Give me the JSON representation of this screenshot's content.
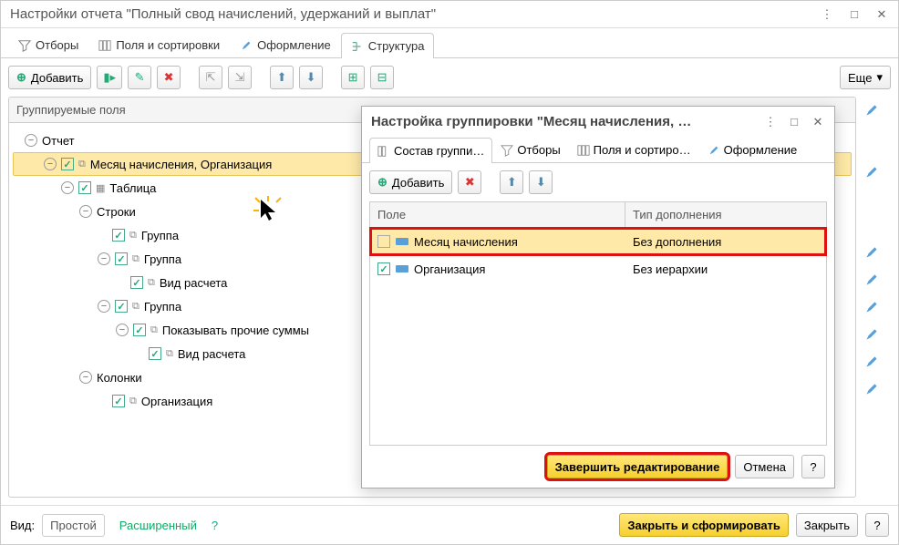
{
  "window": {
    "title": "Настройки отчета \"Полный свод начислений, удержаний и выплат\""
  },
  "mainTabs": {
    "t0": "Отборы",
    "t1": "Поля и сортировки",
    "t2": "Оформление",
    "t3": "Структура"
  },
  "toolbar": {
    "add": "Добавить",
    "more": "Еще"
  },
  "tree": {
    "header": "Группируемые поля",
    "root": "Отчет",
    "n1": "Месяц начисления, Организация",
    "n2": "Таблица",
    "n3": "Строки",
    "n4": "Группа",
    "n5": "Группа",
    "n6": "Вид расчета",
    "n7": "Группа",
    "n8": "Показывать прочие суммы",
    "n9": "Вид расчета",
    "n10": "Колонки",
    "n11": "Организация"
  },
  "popup": {
    "title": "Настройка группировки \"Месяц начисления, …",
    "tabs": {
      "t0": "Состав группи…",
      "t1": "Отборы",
      "t2": "Поля и сортиро…",
      "t3": "Оформление"
    },
    "add": "Добавить",
    "col1": "Поле",
    "col2": "Тип дополнения",
    "rows": [
      {
        "field": "Месяц начисления",
        "type": "Без дополнения",
        "checked": false
      },
      {
        "field": "Организация",
        "type": "Без иерархии",
        "checked": true
      }
    ],
    "finish": "Завершить редактирование",
    "cancel": "Отмена"
  },
  "bottom": {
    "viewLabel": "Вид:",
    "simple": "Простой",
    "advanced": "Расширенный",
    "closeForm": "Закрыть и сформировать",
    "close": "Закрыть"
  }
}
